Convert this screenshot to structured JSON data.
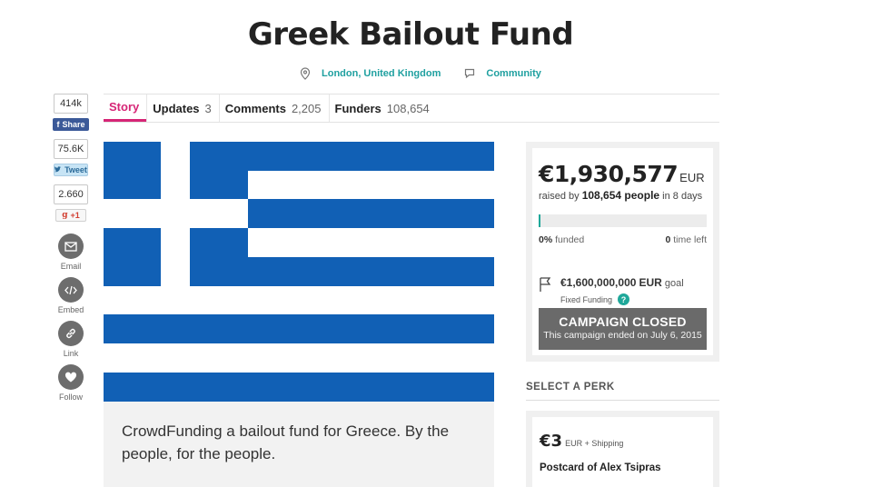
{
  "campaign": {
    "title": "Greek Bailout Fund",
    "location": "London, United Kingdom",
    "category": "Community"
  },
  "tabs": [
    {
      "label": "Story",
      "count": ""
    },
    {
      "label": "Updates",
      "count": "3"
    },
    {
      "label": "Comments",
      "count": "2,205"
    },
    {
      "label": "Funders",
      "count": "108,654"
    }
  ],
  "share": {
    "facebook_count": "414k",
    "facebook_label": "Share",
    "twitter_count": "75.6K",
    "twitter_label": "Tweet",
    "gplus_count": "2.660",
    "gplus_label": "+1",
    "email_label": "Email",
    "embed_label": "Embed",
    "link_label": "Link",
    "follow_label": "Follow"
  },
  "description": "CrowdFunding a bailout fund for Greece. By the people, for the people.",
  "funding": {
    "amount": "€1,930,577",
    "currency": "EUR",
    "raised_prefix": "raised by",
    "people": "108,654 people",
    "raised_suffix": "in 8 days",
    "percent_funded": "0%",
    "funded_label": "funded",
    "progress_fraction": 0.012,
    "time_left": "0",
    "time_left_label": "time left",
    "goal_amount": "€1,600,000,000",
    "goal_currency": "EUR",
    "goal_label": "goal",
    "funding_type": "Fixed Funding",
    "closed_title": "CAMPAIGN CLOSED",
    "closed_note": "This campaign ended on July 6, 2015"
  },
  "perks": {
    "heading": "SELECT A PERK",
    "items": [
      {
        "price": "€3",
        "price_note": "EUR + Shipping",
        "name": "Postcard of Alex Tsipras"
      }
    ]
  },
  "colors": {
    "accent_tab": "#d62576",
    "link": "#1fa0a0",
    "progress": "#1fa89a",
    "flag_blue": "#1160b5"
  }
}
